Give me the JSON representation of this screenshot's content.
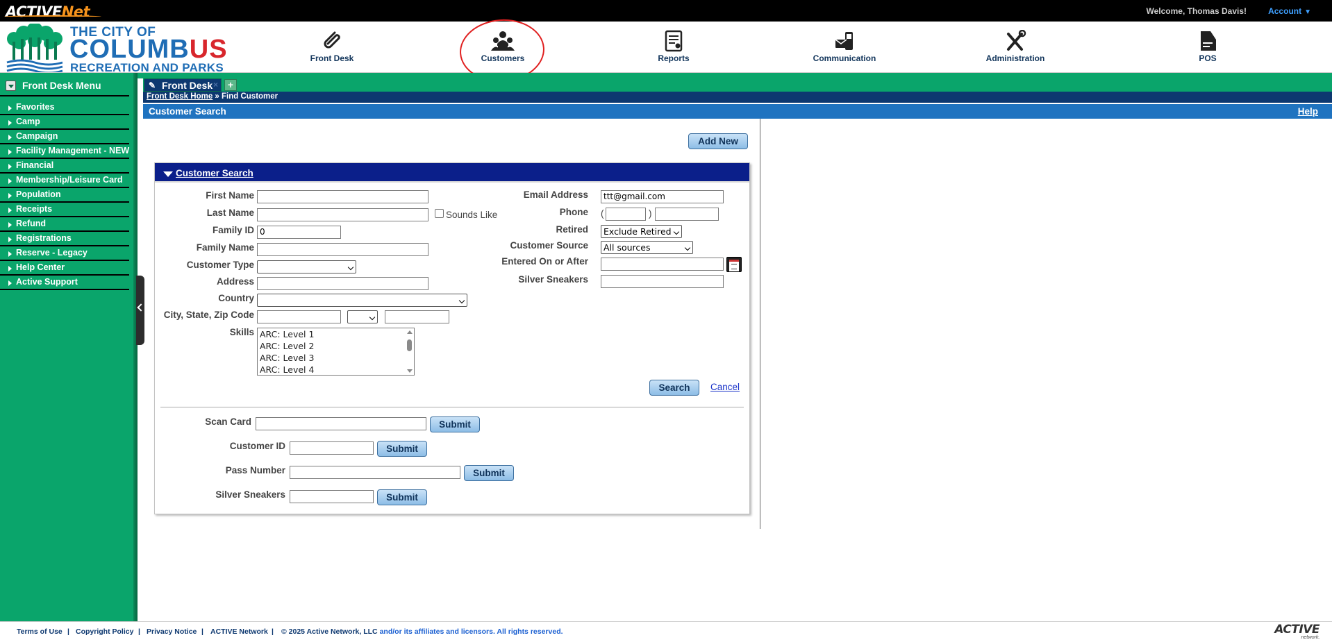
{
  "topbar": {
    "brand_active": "ACTIVE",
    "brand_net": "Net",
    "welcome": "Welcome, Thomas Davis!",
    "account": "Account"
  },
  "logo": {
    "line1": "THE CITY OF",
    "line2a": "COLUMB",
    "line2b": "US",
    "line3": "RECREATION AND PARKS"
  },
  "nav": [
    {
      "label": "Front Desk",
      "icon": "paperclip-icon"
    },
    {
      "label": "Customers",
      "icon": "people-icon"
    },
    {
      "label": "Reports",
      "icon": "report-icon"
    },
    {
      "label": "Communication",
      "icon": "phone-icon"
    },
    {
      "label": "Administration",
      "icon": "tools-icon"
    },
    {
      "label": "POS",
      "icon": "receipt-icon"
    }
  ],
  "sidebar": {
    "title": "Front Desk Menu",
    "items": [
      "Favorites",
      "Camp",
      "Campaign",
      "Facility Management - NEW",
      "Financial",
      "Membership/Leisure Card",
      "Population",
      "Receipts",
      "Refund",
      "Registrations",
      "Reserve - Legacy",
      "Help Center",
      "Active Support"
    ]
  },
  "tab": {
    "label": "Front Desk",
    "add": "+"
  },
  "breadcrumb": {
    "home": "Front Desk Home",
    "sep": " » ",
    "current": "Find Customer"
  },
  "page": {
    "title": "Customer Search",
    "help": "Help",
    "add_new": "Add New"
  },
  "panel": {
    "title": "Customer Search"
  },
  "form": {
    "first_name": {
      "label": "First Name",
      "value": ""
    },
    "last_name": {
      "label": "Last Name",
      "value": "",
      "sounds_like": "Sounds Like"
    },
    "family_id": {
      "label": "Family ID",
      "value": "0"
    },
    "family_name": {
      "label": "Family Name",
      "value": ""
    },
    "customer_type": {
      "label": "Customer Type",
      "value": ""
    },
    "address": {
      "label": "Address",
      "value": ""
    },
    "country": {
      "label": "Country",
      "value": ""
    },
    "city_state_zip": {
      "label": "City, State, Zip Code",
      "city": "",
      "state": "",
      "zip": ""
    },
    "skills": {
      "label": "Skills",
      "options": [
        "ARC: Level 1",
        "ARC: Level 2",
        "ARC: Level 3",
        "ARC: Level 4"
      ]
    },
    "email": {
      "label": "Email Address",
      "value": "ttt@gmail.com"
    },
    "phone": {
      "label": "Phone",
      "open": "(",
      "close": ")",
      "area": "",
      "number": ""
    },
    "retired": {
      "label": "Retired",
      "value": "Exclude Retired"
    },
    "customer_source": {
      "label": "Customer Source",
      "value": "All sources"
    },
    "entered_on": {
      "label": "Entered On or After",
      "value": ""
    },
    "silver_sneakers": {
      "label": "Silver Sneakers",
      "value": ""
    },
    "search": "Search",
    "cancel": "Cancel"
  },
  "lookups": {
    "scan_card": {
      "label": "Scan Card",
      "button": "Submit"
    },
    "customer_id": {
      "label": "Customer ID",
      "button": "Submit"
    },
    "pass_number": {
      "label": "Pass Number",
      "button": "Submit"
    },
    "silver_sneakers": {
      "label": "Silver Sneakers",
      "button": "Submit"
    }
  },
  "footer": {
    "terms": "Terms of Use",
    "copyright_policy": "Copyright Policy",
    "privacy": "Privacy Notice",
    "network": "ACTIVE Network",
    "sep": "|",
    "copy_a": "© 2025 Active Network, LLC",
    "copy_b": " and/or its affiliates and licensors. All rights reserved.",
    "logo": "ACTIVE",
    "logo_sub": "network."
  },
  "colors": {
    "sidebar_green": "#0aa56b",
    "navy": "#0d3870",
    "title_blue": "#1f73c0",
    "panel_head": "#0b1f8a",
    "annotation_red": "#e02020"
  }
}
